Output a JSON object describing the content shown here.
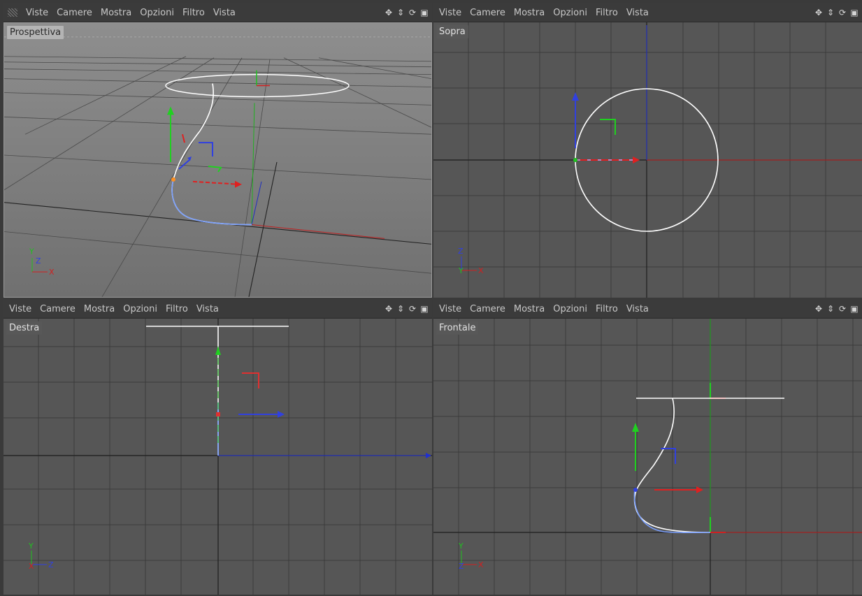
{
  "menu": [
    "Viste",
    "Camere",
    "Mostra",
    "Opzioni",
    "Filtro",
    "Vista"
  ],
  "nav_icons": [
    "move-icon",
    "zoom-icon",
    "rotate-icon",
    "maximize-icon"
  ],
  "viewports": {
    "tl": {
      "label": "Prospettiva"
    },
    "tr": {
      "label": "Sopra"
    },
    "bl": {
      "label": "Destra"
    },
    "br": {
      "label": "Frontale"
    }
  },
  "axes": {
    "tl": {
      "up": "Y",
      "mid": "Z",
      "right": "X"
    },
    "tr": {
      "up": "Z",
      "mid": "Y",
      "right": "X"
    },
    "bl": {
      "up": "Y",
      "mid": "X",
      "right": "Z"
    },
    "br": {
      "up": "Y",
      "mid": "Z",
      "right": "X"
    }
  },
  "colors": {
    "x": "#d02020",
    "y": "#20c020",
    "z": "#2030d0",
    "grid": "#262626",
    "spline": "#ffffff"
  }
}
